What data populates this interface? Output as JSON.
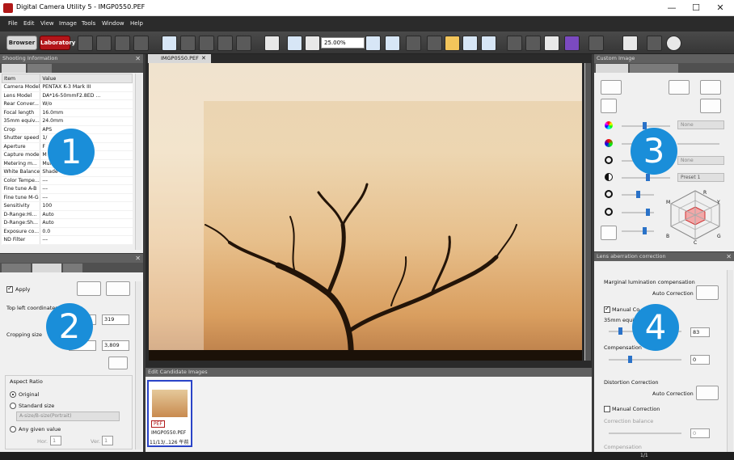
{
  "window": {
    "title": "Digital Camera Utility 5 - IMGP0550.PEF",
    "minimize": "—",
    "maximize": "☐",
    "close": "✕"
  },
  "menu": [
    "File",
    "Edit",
    "View",
    "Image",
    "Tools",
    "Window",
    "Help"
  ],
  "toolbar": {
    "browser_label": "Browser",
    "laboratory_label": "Laboratory",
    "zoom_value": "25.00%"
  },
  "shooting_info": {
    "title": "Shooting Information",
    "col_item": "Item",
    "col_value": "Value",
    "rows": [
      [
        "Camera Model",
        "PENTAX K-3 Mark III"
      ],
      [
        "Lens Model",
        "DA*16-50mmF2.8ED ..."
      ],
      [
        "Rear Conver...",
        "W/o"
      ],
      [
        "Focal length",
        "16.0mm"
      ],
      [
        "35mm equiv...",
        "24.0mm"
      ],
      [
        "Crop",
        "APS"
      ],
      [
        "Shutter speed",
        "1/"
      ],
      [
        "Aperture",
        "F"
      ],
      [
        "Capture mode",
        "M"
      ],
      [
        "Metering m...",
        "Mul   te..."
      ],
      [
        "White Balance",
        "Shade"
      ],
      [
        "Color Tempe...",
        "---"
      ],
      [
        "Fine tune A-B",
        "---"
      ],
      [
        "Fine tune M-G",
        "---"
      ],
      [
        "Sensitivity",
        "100"
      ],
      [
        "D-Range:Hi...",
        "Auto"
      ],
      [
        "D-Range:Sh...",
        "Auto"
      ],
      [
        "Exposure co...",
        "0.0"
      ],
      [
        "ND Filter",
        "---"
      ]
    ]
  },
  "crop": {
    "apply_label": "Apply",
    "top_left_label": "Top left coordinates",
    "top_left_y": "319",
    "cropping_size_label": "Cropping size",
    "size_h": "3,809",
    "aspect_ratio_label": "Aspect Ratio",
    "original_label": "Original",
    "standard_label": "Standard size",
    "standard_select": "A-size/B-size(Portrait)",
    "any_label": "Any given value",
    "hor_label": "Hor.",
    "hor_value": "1",
    "ver_label": "Ver.",
    "ver_value": "1"
  },
  "viewer": {
    "tab_label": "IMGP0550.PEF",
    "tab_close": "✕"
  },
  "candidates": {
    "title": "Edit Candidate Images",
    "thumb_badge": "PEF",
    "thumb_name": "IMGP0550.PEF",
    "thumb_date": "11/13/..126 午前"
  },
  "custom_image": {
    "title": "Custom Image",
    "select_none_1": "None",
    "select_none_2": "None",
    "select_preset": "Preset 1",
    "radar_labels": {
      "r": "R",
      "y": "Y",
      "g": "G",
      "b": "B",
      "m": "M",
      "c": "C"
    }
  },
  "lens": {
    "title": "Lens aberration correction",
    "marginal_label": "Marginal lumination compensation",
    "auto_label_1": "Auto Correction",
    "manual_label_1": "Manual Co",
    "equiv_label": "35mm equi",
    "equiv_value": "83",
    "compensation_label": "Compensation",
    "compensation_value": "0",
    "distortion_label": "Distortion Correction",
    "auto_label_2": "Auto Correction",
    "manual_label_2": "Manual Correction",
    "balance_label": "Correction balance",
    "balance_value": "0",
    "compensation2_label": "Compensation"
  },
  "status": {
    "page": "1/1"
  },
  "badges": [
    "1",
    "2",
    "3",
    "4"
  ]
}
